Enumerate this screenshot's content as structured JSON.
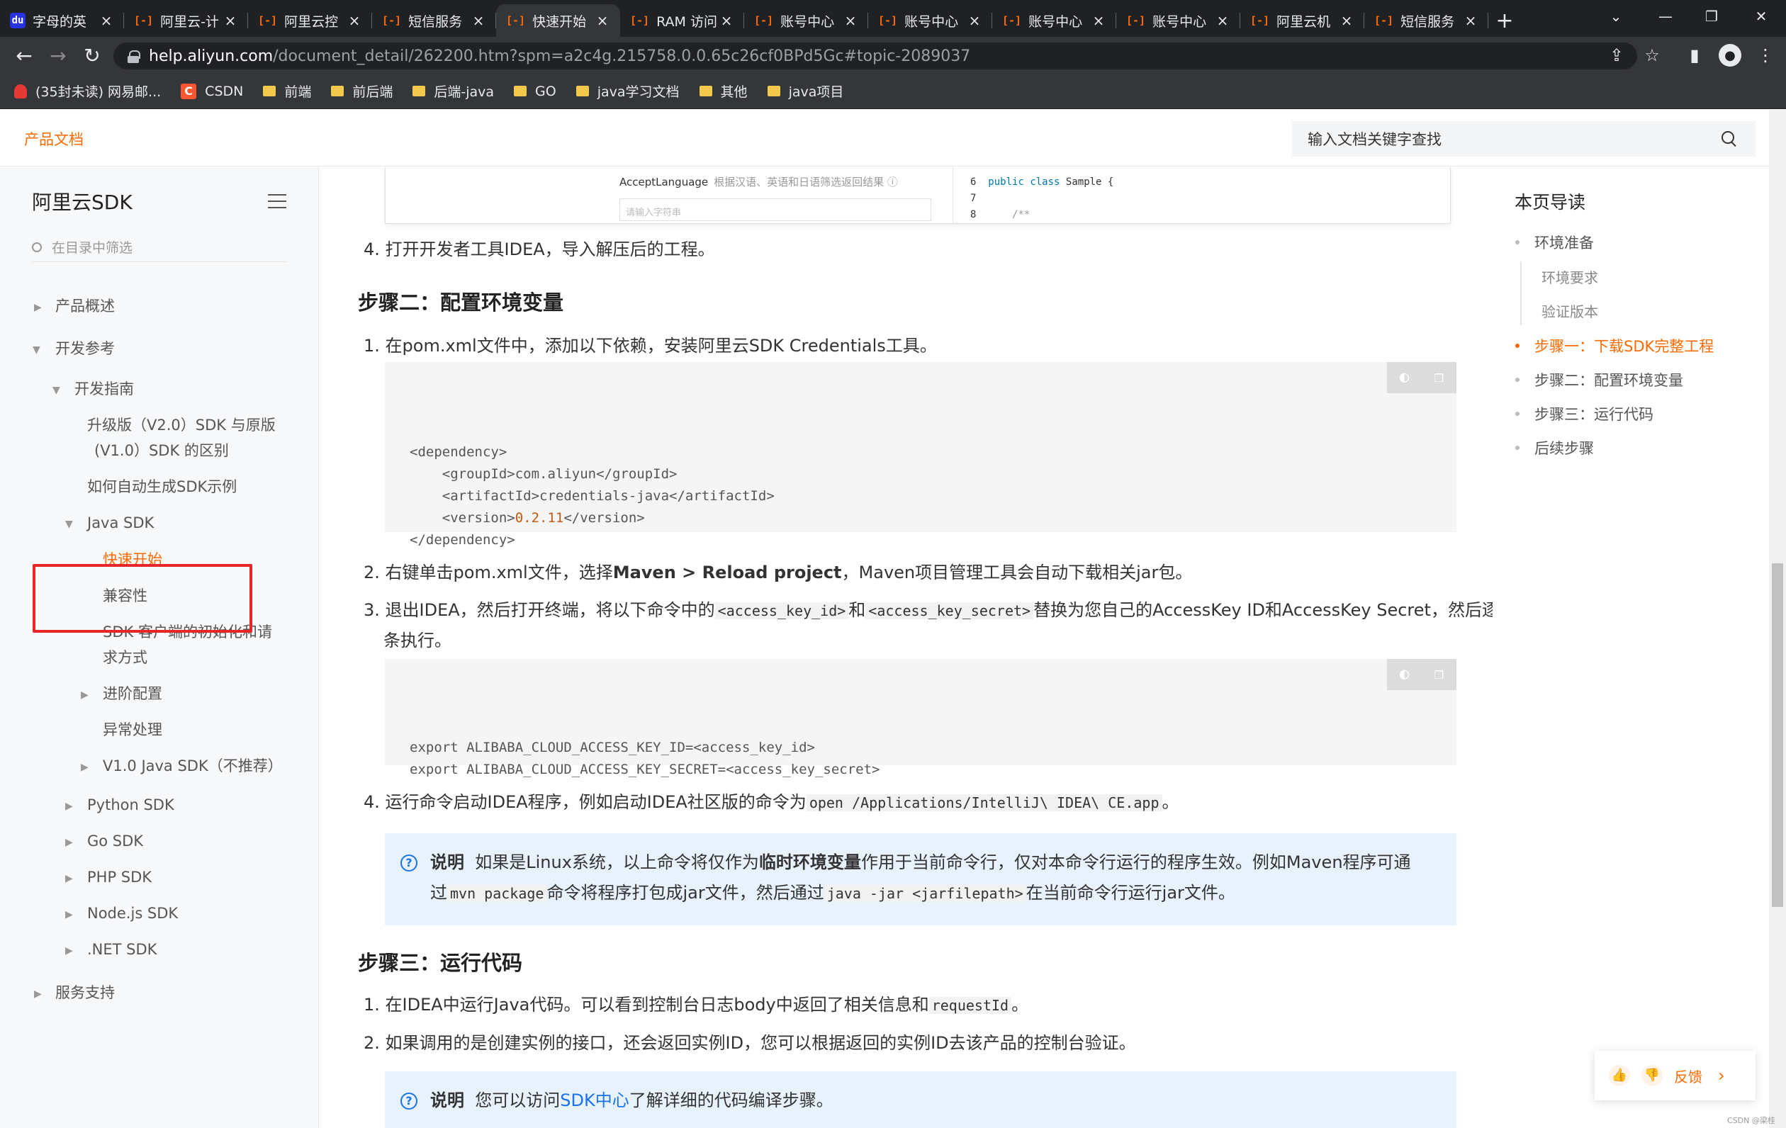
{
  "browser": {
    "tabs": [
      {
        "title": "字母的英",
        "icon": "baidu-icon",
        "active": false
      },
      {
        "title": "阿里云-计",
        "icon": "aliyun-icon",
        "active": false
      },
      {
        "title": "阿里云控",
        "icon": "aliyun-icon",
        "active": false
      },
      {
        "title": "短信服务",
        "icon": "aliyun-icon",
        "active": false
      },
      {
        "title": "快速开始",
        "icon": "aliyun-icon",
        "active": true
      },
      {
        "title": "RAM 访问",
        "icon": "aliyun-icon",
        "active": false
      },
      {
        "title": "账号中心",
        "icon": "aliyun-icon",
        "active": false
      },
      {
        "title": "账号中心",
        "icon": "aliyun-icon",
        "active": false
      },
      {
        "title": "账号中心",
        "icon": "aliyun-icon",
        "active": false
      },
      {
        "title": "账号中心",
        "icon": "aliyun-icon",
        "active": false
      },
      {
        "title": "阿里云机",
        "icon": "aliyun-icon",
        "active": false
      },
      {
        "title": "短信服务",
        "icon": "aliyun-icon",
        "active": false
      }
    ],
    "url_host": "help.aliyun.com",
    "url_rest": "/document_detail/262200.htm?spm=a2c4g.215758.0.0.65c26cf0BPd5Gc#topic-2089037",
    "bookmarks": [
      {
        "label": "(35封未读) 网易邮...",
        "icon": "mail-icon"
      },
      {
        "label": "CSDN",
        "icon": "csdn-icon"
      },
      {
        "label": "前端",
        "icon": "folder-icon"
      },
      {
        "label": "前后端",
        "icon": "folder-icon"
      },
      {
        "label": "后端-java",
        "icon": "folder-icon"
      },
      {
        "label": "GO",
        "icon": "folder-icon"
      },
      {
        "label": "java学习文档",
        "icon": "folder-icon"
      },
      {
        "label": "其他",
        "icon": "folder-icon"
      },
      {
        "label": "java项目",
        "icon": "folder-icon"
      }
    ]
  },
  "header": {
    "product_docs": "产品文档",
    "search_placeholder": "输入文档关键字查找"
  },
  "sidebar": {
    "title": "阿里云SDK",
    "filter_placeholder": "在目录中筛选",
    "items": [
      {
        "label": "产品概述"
      },
      {
        "label": "开发参考"
      },
      {
        "label": "开发指南"
      },
      {
        "label": "升级版（V2.0）SDK 与原版"
      },
      {
        "label": "(V1.0）SDK 的区别"
      },
      {
        "label": "如何自动生成SDK示例"
      },
      {
        "label": "Java SDK"
      },
      {
        "label": "快速开始"
      },
      {
        "label": "兼容性"
      },
      {
        "label": "SDK 客户端的初始化和请"
      },
      {
        "label": "求方式"
      },
      {
        "label": "进阶配置"
      },
      {
        "label": "异常处理"
      },
      {
        "label": "V1.0 Java SDK（不推荐）"
      },
      {
        "label": "Python SDK"
      },
      {
        "label": "Go SDK"
      },
      {
        "label": "PHP SDK"
      },
      {
        "label": "Node.js SDK"
      },
      {
        "label": ".NET SDK"
      },
      {
        "label": "服务支持"
      }
    ]
  },
  "content": {
    "screenshot": {
      "label": "AcceptLanguage",
      "label_desc": "根据汉语、英语和日语筛选返回结果 ⓘ",
      "input_placeholder": "请输入字符串",
      "code_lines": [
        "6",
        "7",
        "8"
      ],
      "code_kw1": "public",
      "code_kw2": "class",
      "code_name": "Sample {",
      "code_comment": "/**"
    },
    "step1_item4": "4. 打开开发者工具IDEA，导入解压后的工程。",
    "step2_title": "步骤二：配置环境变量",
    "s2_1": "1. 在pom.xml文件中，添加以下依赖，安装阿里云SDK Credentials工具。",
    "code1": {
      "l1": "<dependency>",
      "l2": "    <groupId>com.aliyun</groupId>",
      "l3": "    <artifactId>credentials-java</artifactId>",
      "l4_a": "    <version>",
      "l4_num": "0.2.11",
      "l4_b": "</version>",
      "l5": "</dependency>"
    },
    "s2_2_a": "2. 右键单击pom.xml文件，选择",
    "s2_2_bold": "Maven > Reload project",
    "s2_2_b": "，Maven项目管理工具会自动下载相关jar包。",
    "s2_3_a": "3. 退出IDEA，然后打开终端，将以下命令中的",
    "s2_3_code1": "<access_key_id>",
    "s2_3_b": "和",
    "s2_3_code2": "<access_key_secret>",
    "s2_3_c": "替换为您自己的AccessKey ID和AccessKey Secret，然后逐",
    "s2_3_d": "条执行。",
    "code2": {
      "l1": "export ALIBABA_CLOUD_ACCESS_KEY_ID=<access_key_id>",
      "l2": "export ALIBABA_CLOUD_ACCESS_KEY_SECRET=<access_key_secret>"
    },
    "s2_4_a": "4. 运行命令启动IDEA程序，例如启动IDEA社区版的命令为",
    "s2_4_code": "open /Applications/IntelliJ\\ IDEA\\ CE.app",
    "s2_4_b": "。",
    "note1": {
      "label": "说明",
      "a": "如果是Linux系统，以上命令将仅作为",
      "bold": "临时环境变量",
      "b": "作用于当前命令行，仅对本命令行运行的程序生效。例如Maven程序可通",
      "c": "过",
      "code1": "mvn package",
      "d": "命令将程序打包成jar文件，然后通过",
      "code2": "java -jar <jarfilepath>",
      "e": "在当前命令行运行jar文件。"
    },
    "step3_title": "步骤三：运行代码",
    "s3_1_a": "1. 在IDEA中运行Java代码。可以看到控制台日志body中返回了相关信息和",
    "s3_1_code": "requestId",
    "s3_1_b": "。",
    "s3_2": "2. 如果调用的是创建实例的接口，还会返回实例ID，您可以根据返回的实例ID去该产品的控制台验证。",
    "note2": {
      "label": "说明",
      "a": "您可以访问",
      "link": "SDK中心",
      "b": "了解详细的代码编译步骤。"
    }
  },
  "toc": {
    "title": "本页导读",
    "items": [
      {
        "label": "环境准备"
      },
      {
        "label": "环境要求"
      },
      {
        "label": "验证版本"
      },
      {
        "label": "步骤一：下载SDK完整工程"
      },
      {
        "label": "步骤二：配置环境变量"
      },
      {
        "label": "步骤三：运行代码"
      },
      {
        "label": "后续步骤"
      }
    ]
  },
  "feedback": {
    "label": "反馈"
  },
  "watermark": "CSDN @梁桂",
  "colors": {
    "accent": "#ff6a00",
    "link": "#1a73e8",
    "highlight_box": "#e8262a"
  }
}
